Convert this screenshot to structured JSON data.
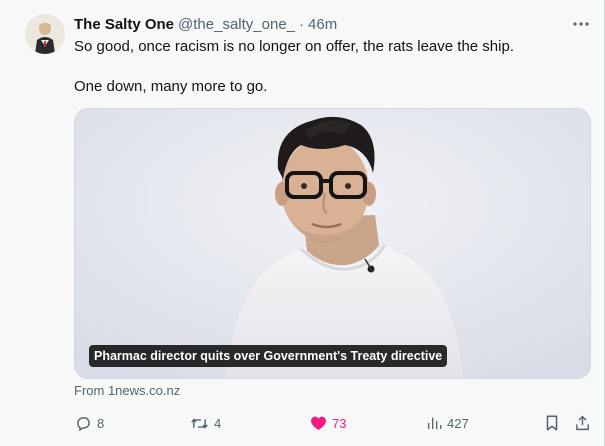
{
  "tweet": {
    "author": {
      "display_name": "The Salty One",
      "handle": "@the_salty_one_",
      "separator": "·",
      "time": "46m"
    },
    "text_lines": [
      "So good, once racism is no longer on offer, the rats leave the ship.",
      "One down, many more to go."
    ],
    "media": {
      "caption": "Pharmac director quits over Government's Treaty directive"
    },
    "source": "From 1news.co.nz",
    "actions": {
      "replies": "8",
      "reposts": "4",
      "likes": "73",
      "views": "427"
    },
    "colors": {
      "like_active": "#f91880",
      "secondary_text": "#536471"
    },
    "icons": [
      "more-icon",
      "reply-icon",
      "repost-icon",
      "like-icon",
      "views-icon",
      "bookmark-icon",
      "share-icon"
    ]
  }
}
